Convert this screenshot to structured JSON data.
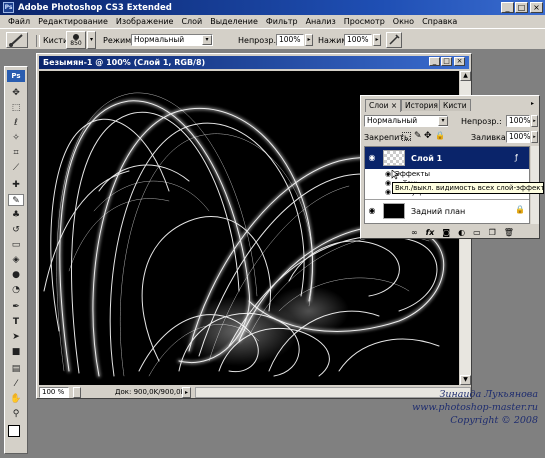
{
  "app": {
    "title": "Adobe Photoshop CS3 Extended",
    "logo": "Ps"
  },
  "window_controls": {
    "minimize": "_",
    "maximize": "□",
    "close": "×"
  },
  "menu": [
    "Файл",
    "Редактирование",
    "Изображение",
    "Слой",
    "Выделение",
    "Фильтр",
    "Анализ",
    "Просмотр",
    "Окно",
    "Справка"
  ],
  "options": {
    "brush_label": "Кисти:",
    "brush_size": "850",
    "mode_label": "Режим:",
    "mode_value": "Нормальный",
    "opacity_label": "Непрозр.:",
    "opacity_value": "100%",
    "flow_label": "Нажим:",
    "flow_value": "100%"
  },
  "document": {
    "title": "Безымян-1 @ 100% (Слой 1, RGB/8)",
    "zoom": "100 %",
    "doc_info": "Док: 900,0K/900,0K"
  },
  "layers_panel": {
    "tabs": [
      "Слои ×",
      "История",
      "Кисти"
    ],
    "blend_mode": "Нормальный",
    "opacity_label": "Непрозр.:",
    "opacity_value": "100%",
    "lock_label": "Закрепить:",
    "fill_label": "Заливка:",
    "fill_value": "100%",
    "layer1": {
      "name": "Слой 1"
    },
    "effects_label": "Эффекты",
    "effect1": "Тень",
    "effect2": "Внутреннее свечение",
    "background": {
      "name": "Задний план"
    },
    "footer_icons": [
      "link-icon",
      "fx",
      "mask-icon",
      "adjust-icon",
      "folder-icon",
      "new-layer-icon",
      "trash-icon"
    ]
  },
  "tooltip": "Вкл./выкл. видимость всех слой-эффектов",
  "credit": {
    "line1": "Зинаида Лукьянова",
    "line2": "www.photoshop-master.ru",
    "line3": "Copyright © 2008"
  },
  "colors": {
    "titlebar": "#0a246a",
    "panel": "#d4d0c8",
    "selected_layer": "#0a246a",
    "canvas": "#000000",
    "credit": "#1e2c6e"
  }
}
